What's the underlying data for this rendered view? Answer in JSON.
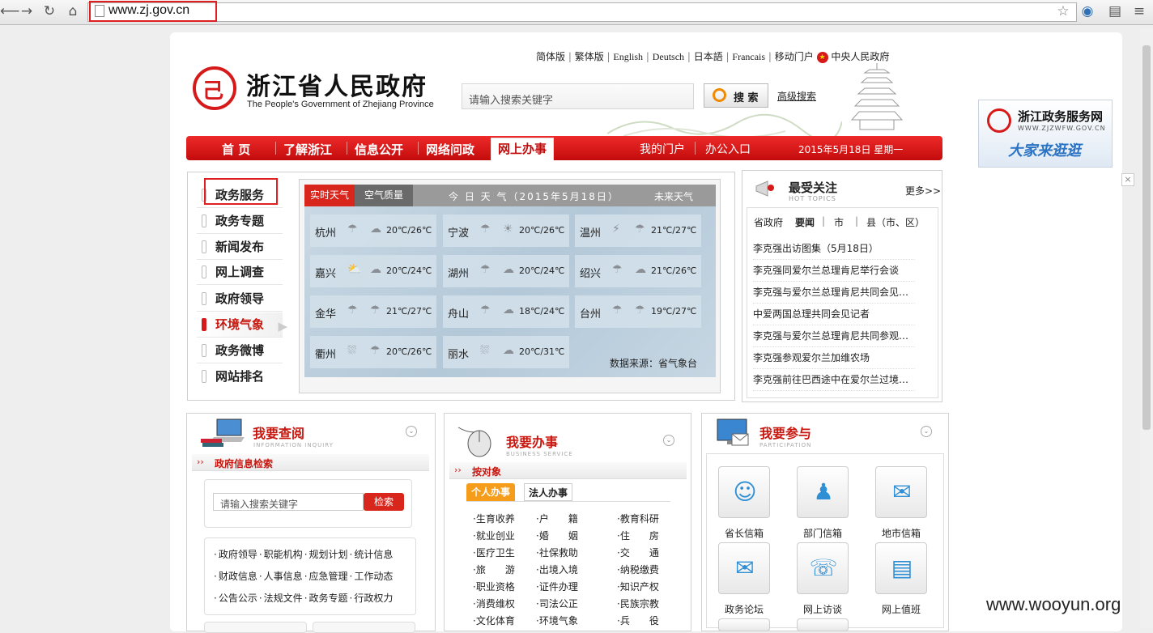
{
  "browser": {
    "url": "www.zj.gov.cn"
  },
  "header": {
    "lang_links": [
      "简体版",
      "繁体版",
      "English",
      "Deutsch",
      "日本語",
      "Francais",
      "移动门户"
    ],
    "central_gov": "中央人民政府",
    "title": "浙江省人民政府",
    "subtitle": "The People's Government of Zhejiang Province",
    "search_placeholder": "请输入搜索关键字",
    "search_button": "搜 索",
    "advanced_search": "高级搜索"
  },
  "nav": {
    "items": [
      "首 页",
      "了解浙江",
      "信息公开",
      "网络问政",
      "网上办事"
    ],
    "right_items": [
      "我的门户",
      "办公入口"
    ],
    "date": "2015年5月18日  星期一"
  },
  "ad": {
    "title": "浙江政务服务网",
    "url": "WWW.ZJZWFW.GOV.CN",
    "slogan": "大家来逛逛"
  },
  "left_menu": [
    "政务服务",
    "政务专题",
    "新闻发布",
    "网上调查",
    "政府领导",
    "环境气象",
    "政务微博",
    "网站排名"
  ],
  "weather": {
    "tab_realtime": "实时天气",
    "tab_air": "空气质量",
    "title": "今 日 天 气（2015年5月18日）",
    "future": "未来天气",
    "source": "数据来源：省气象台",
    "cities": [
      {
        "name": "杭州",
        "temp": "20℃/26℃",
        "icons": [
          "rain-icon",
          "cloud-icon"
        ]
      },
      {
        "name": "宁波",
        "temp": "20℃/26℃",
        "icons": [
          "rain-icon",
          "sun-rain-icon"
        ]
      },
      {
        "name": "温州",
        "temp": "21℃/27℃",
        "icons": [
          "thunder-icon",
          "rain-icon"
        ]
      },
      {
        "name": "嘉兴",
        "temp": "20℃/24℃",
        "icons": [
          "sun-cloud-icon",
          "cloud-icon"
        ]
      },
      {
        "name": "湖州",
        "temp": "20℃/24℃",
        "icons": [
          "rain-icon",
          "cloud-icon"
        ]
      },
      {
        "name": "绍兴",
        "temp": "21℃/26℃",
        "icons": [
          "rain-icon",
          "cloud-icon"
        ]
      },
      {
        "name": "金华",
        "temp": "21℃/27℃",
        "icons": [
          "rain-icon",
          "rain-icon"
        ]
      },
      {
        "name": "舟山",
        "temp": "18℃/24℃",
        "icons": [
          "rain-icon",
          "cloud-icon"
        ]
      },
      {
        "name": "台州",
        "temp": "19℃/27℃",
        "icons": [
          "rain-icon",
          "rain-icon"
        ]
      },
      {
        "name": "衢州",
        "temp": "20℃/26℃",
        "icons": [
          "heavy-rain-icon",
          "rain-icon"
        ]
      },
      {
        "name": "丽水",
        "temp": "20℃/31℃",
        "icons": [
          "heavy-rain-icon",
          "cloud-icon"
        ]
      }
    ]
  },
  "hot": {
    "title": "最受关注",
    "subtitle": "HOT TOPICS",
    "more": "更多>>",
    "tabs": [
      "省政府",
      "要闻",
      "市",
      "县（市、区）"
    ],
    "items": [
      "李克强出访图集（5月18日）",
      "李克强同爱尔兰总理肯尼举行会谈",
      "李克强与爱尔兰总理肯尼共同会见…",
      "中爱两国总理共同会见记者",
      "李克强与爱尔兰总理肯尼共同参观…",
      "李克强参观爱尔兰加维农场",
      "李克强前往巴西途中在爱尔兰过境…"
    ]
  },
  "inquiry": {
    "title": "我要查阅",
    "subtitle": "INFORMATION INQUIRY",
    "sub": "政府信息检索",
    "search_placeholder": "请输入搜索关键字",
    "search_button": "检索",
    "links": [
      [
        "政府领导",
        "职能机构",
        "规划计划",
        "统计信息"
      ],
      [
        "财政信息",
        "人事信息",
        "应急管理",
        "工作动态"
      ],
      [
        "公告公示",
        "法规文件",
        "政务专题",
        "行政权力"
      ]
    ]
  },
  "service": {
    "title": "我要办事",
    "subtitle": "BUSINESS SERVICE",
    "sub": "按对象",
    "tab_personal": "个人办事",
    "tab_corporate": "法人办事",
    "items": [
      [
        "生育收养",
        "户　　籍",
        "教育科研"
      ],
      [
        "就业创业",
        "婚　　姻",
        "住　　房"
      ],
      [
        "医疗卫生",
        "社保救助",
        "交　　通"
      ],
      [
        "旅　　游",
        "出境入境",
        "纳税缴费"
      ],
      [
        "职业资格",
        "证件办理",
        "知识产权"
      ],
      [
        "消费维权",
        "司法公正",
        "民族宗教"
      ],
      [
        "文化体育",
        "环境气象",
        "兵　　役"
      ]
    ]
  },
  "participate": {
    "title": "我要参与",
    "subtitle": "PARTICIPATION",
    "tiles": [
      {
        "label": "省长信箱",
        "icon": "governor-icon"
      },
      {
        "label": "部门信箱",
        "icon": "department-icon"
      },
      {
        "label": "地市信箱",
        "icon": "city-mailbox-icon"
      },
      {
        "label": "政务论坛",
        "icon": "envelope-icon"
      },
      {
        "label": "网上访谈",
        "icon": "interview-icon"
      },
      {
        "label": "网上值班",
        "icon": "duty-icon"
      }
    ]
  },
  "watermark": "www.wooyun.org"
}
